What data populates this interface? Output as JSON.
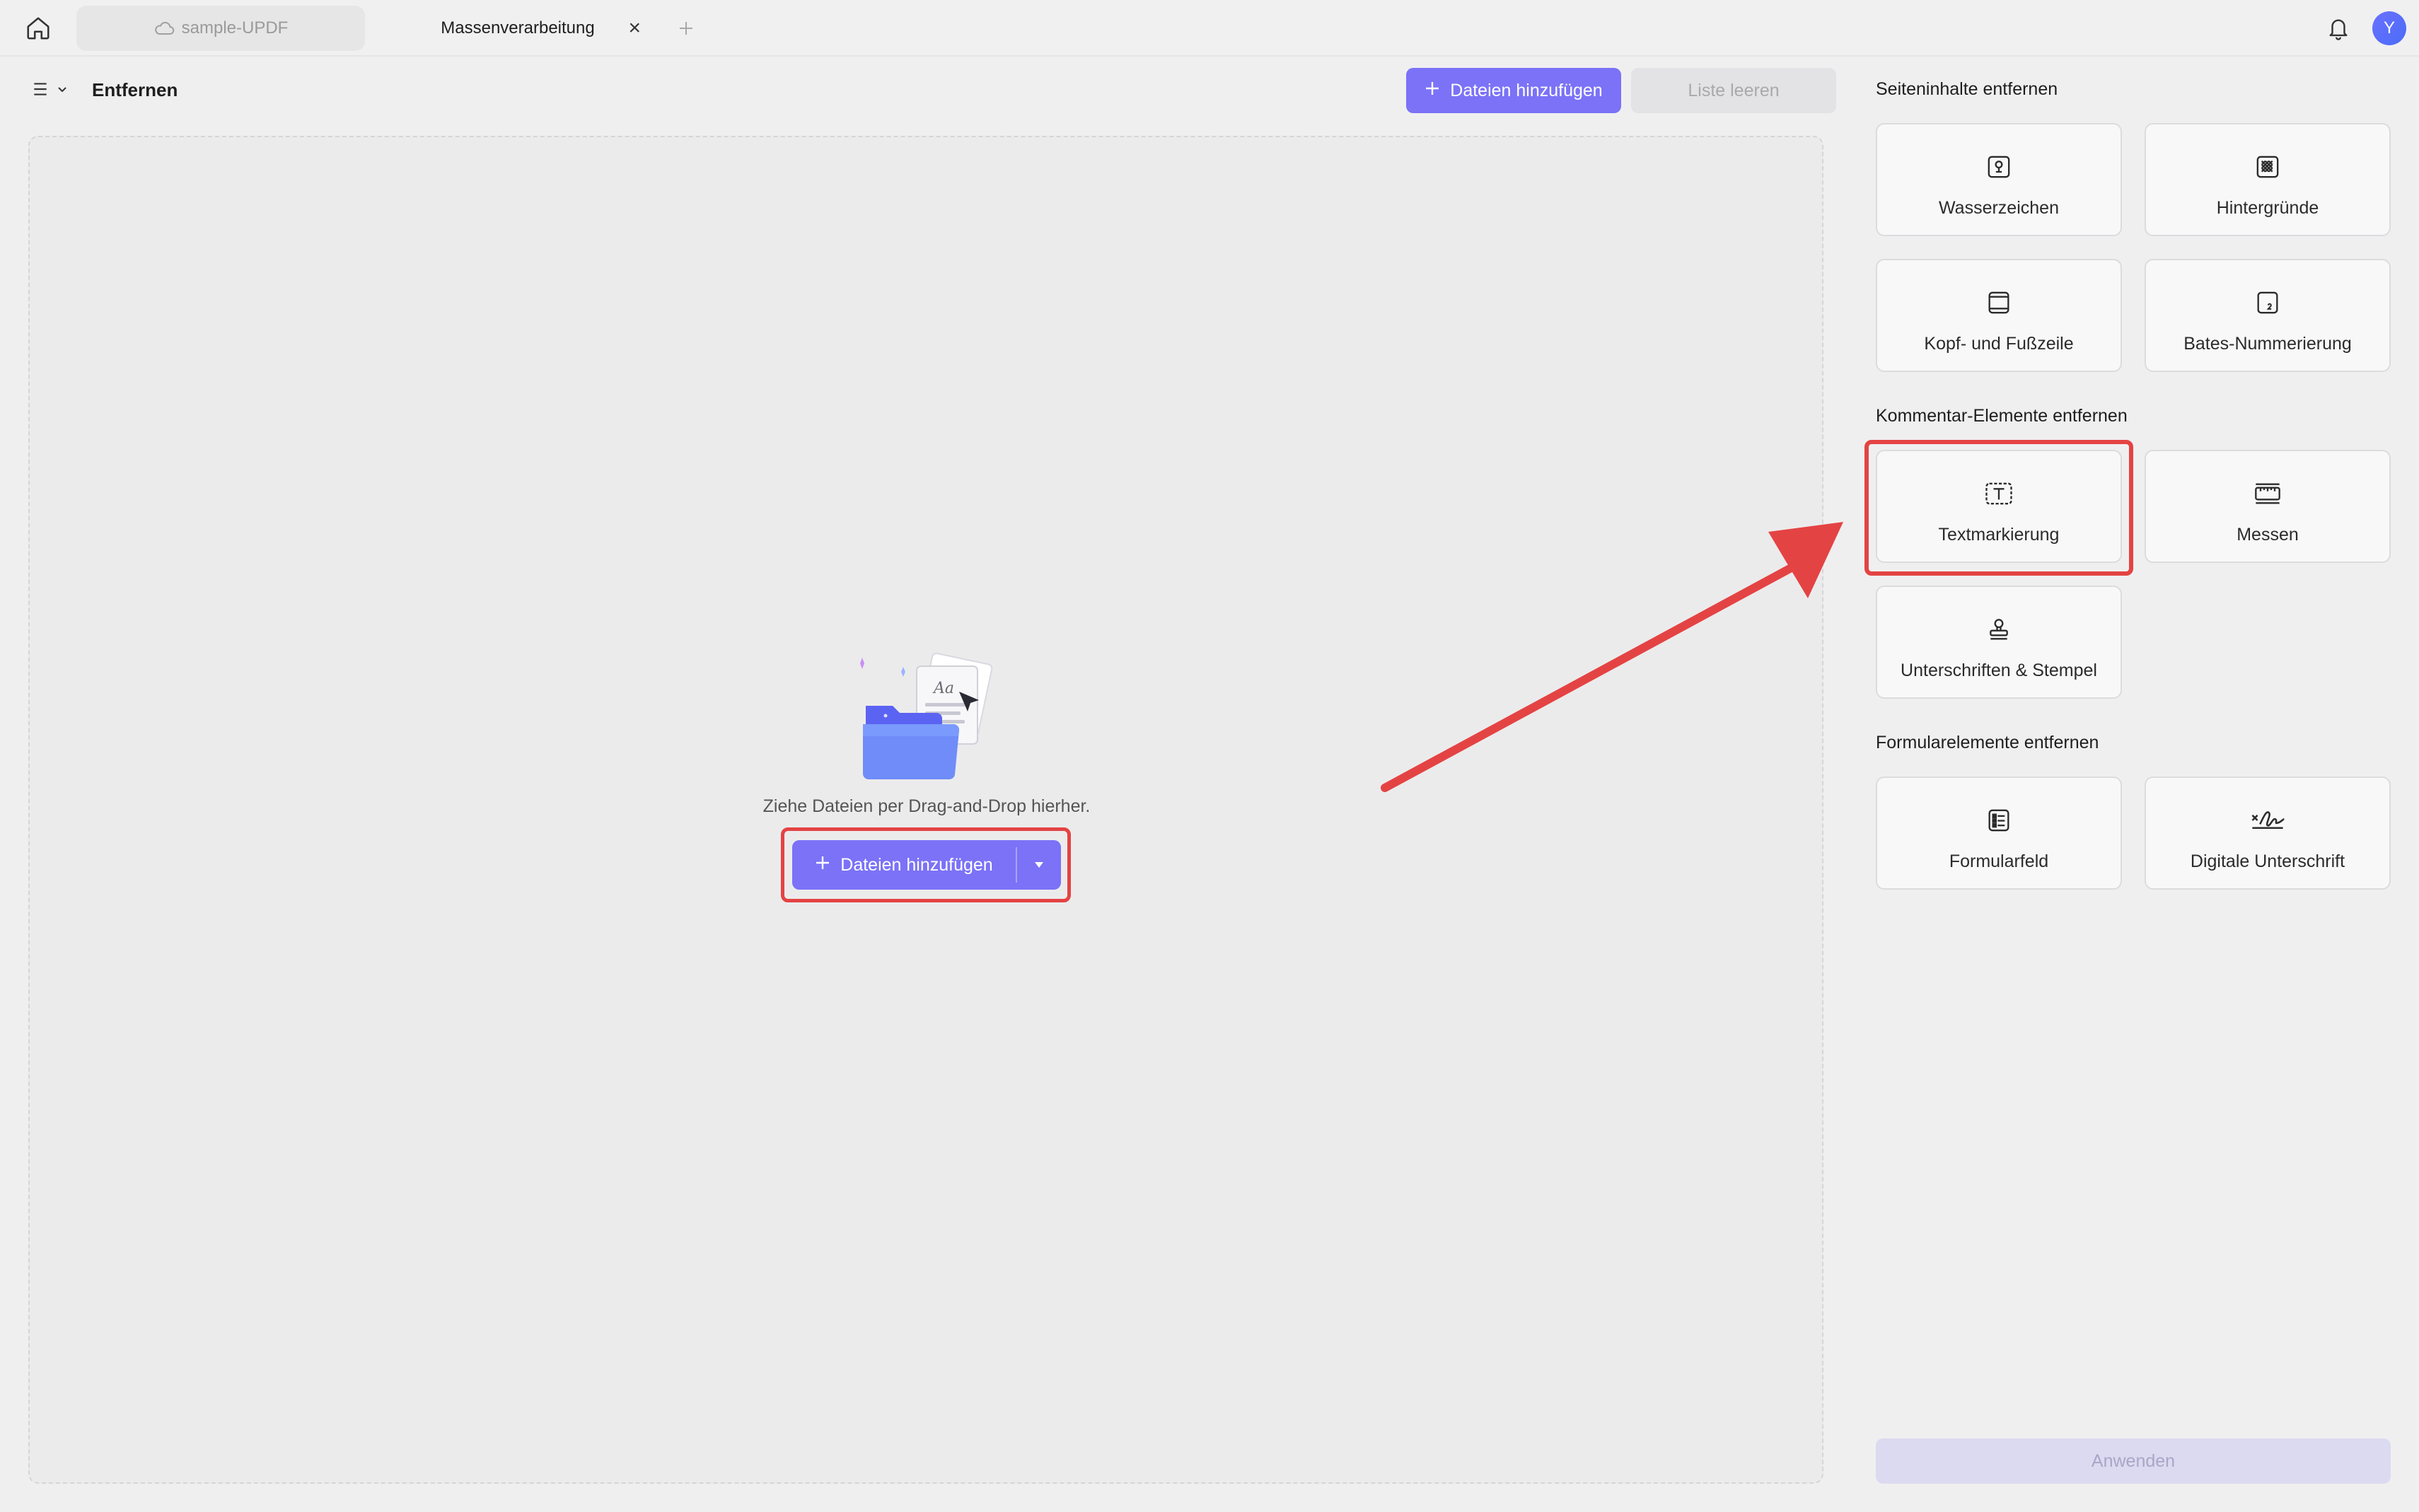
{
  "tabs": [
    {
      "label": "sample-UPDF",
      "icon": "cloud-icon"
    },
    {
      "label": "Massenverarbeitung",
      "close": "×"
    }
  ],
  "avatar_initial": "Y",
  "header": {
    "title": "Entfernen",
    "add_files_label": "Dateien hinzufügen",
    "clear_list_label": "Liste leeren"
  },
  "dropzone": {
    "hint": "Ziehe Dateien per Drag-and-Drop hierher.",
    "add_files_label": "Dateien hinzufügen"
  },
  "sections": [
    {
      "title": "Seiteninhalte entfernen",
      "items": [
        {
          "label": "Wasserzeichen",
          "icon": "watermark-icon"
        },
        {
          "label": "Hintergründe",
          "icon": "background-icon"
        },
        {
          "label": "Kopf- und Fußzeile",
          "icon": "header-footer-icon"
        },
        {
          "label": "Bates-Nummerierung",
          "icon": "bates-numbering-icon"
        }
      ]
    },
    {
      "title": "Kommentar-Elemente entfernen",
      "items": [
        {
          "label": "Textmarkierung",
          "icon": "text-markup-icon",
          "highlighted": true
        },
        {
          "label": "Messen",
          "icon": "measure-icon"
        },
        {
          "label": "Unterschriften & Stempel",
          "icon": "stamp-icon"
        }
      ]
    },
    {
      "title": "Formularelemente entfernen",
      "items": [
        {
          "label": "Formularfeld",
          "icon": "form-field-icon"
        },
        {
          "label": "Digitale Unterschrift",
          "icon": "digital-signature-icon"
        }
      ]
    }
  ],
  "apply_label": "Anwenden",
  "colors": {
    "accent": "#7b72f7",
    "annotation": "#e44343",
    "background": "#f0eff0"
  }
}
